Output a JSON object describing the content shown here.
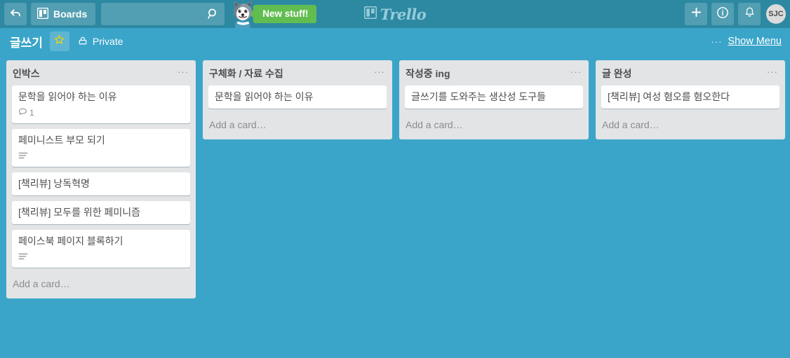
{
  "colors": {
    "header_bar": "#2d89a1",
    "board_background": "#3ba5c9",
    "list_background": "#e2e4e6",
    "card_background": "#ffffff",
    "badge_green": "#61bd4f",
    "star_yellow": "#f2d600",
    "text_dark": "#4d4d4d"
  },
  "header": {
    "back_icon": "back-arrow-icon",
    "boards_label": "Boards",
    "boards_icon": "board-icon",
    "search": {
      "value": "",
      "placeholder": "",
      "icon": "search-icon"
    },
    "mascot_icon": "husky-dog-icon",
    "new_stuff_label": "New stuff!",
    "logo_text": "Trello",
    "logo_icon": "trello-board-icon",
    "add_icon": "plus-icon",
    "info_icon": "info-icon",
    "notifications_icon": "bell-icon",
    "avatar_initials": "SJC"
  },
  "board": {
    "title": "글쓰기",
    "star_icon": "star-icon",
    "visibility_icon": "lock-icon",
    "visibility_label": "Private",
    "menu_dots": "···",
    "show_menu_label": "Show Menu"
  },
  "lists": [
    {
      "title": "인박스",
      "menu": "···",
      "add_card_label": "Add a card…",
      "cards": [
        {
          "title": "문학을 읽어야 하는 이유",
          "badges": [
            {
              "type": "comments",
              "icon": "comment-icon",
              "value": "1"
            }
          ]
        },
        {
          "title": "페미니스트 부모 되기",
          "badges": [
            {
              "type": "description",
              "icon": "description-icon",
              "value": ""
            }
          ]
        },
        {
          "title": "[책리뷰] 낭독혁명",
          "badges": []
        },
        {
          "title": "[책리뷰] 모두를 위한 페미니즘",
          "badges": []
        },
        {
          "title": "페이스북 페이지 블록하기",
          "badges": [
            {
              "type": "description",
              "icon": "description-icon",
              "value": ""
            }
          ]
        }
      ]
    },
    {
      "title": "구체화 / 자료 수집",
      "menu": "···",
      "add_card_label": "Add a card…",
      "cards": [
        {
          "title": "문학을 읽어야 하는 이유",
          "badges": []
        }
      ]
    },
    {
      "title": "작성중 ing",
      "menu": "···",
      "add_card_label": "Add a card…",
      "cards": [
        {
          "title": "글쓰기를 도와주는 생산성 도구들",
          "badges": []
        }
      ]
    },
    {
      "title": "글 완성",
      "menu": "···",
      "add_card_label": "Add a card…",
      "cards": [
        {
          "title": "[책리뷰] 여성 혐오를 혐오한다",
          "badges": []
        }
      ]
    }
  ]
}
